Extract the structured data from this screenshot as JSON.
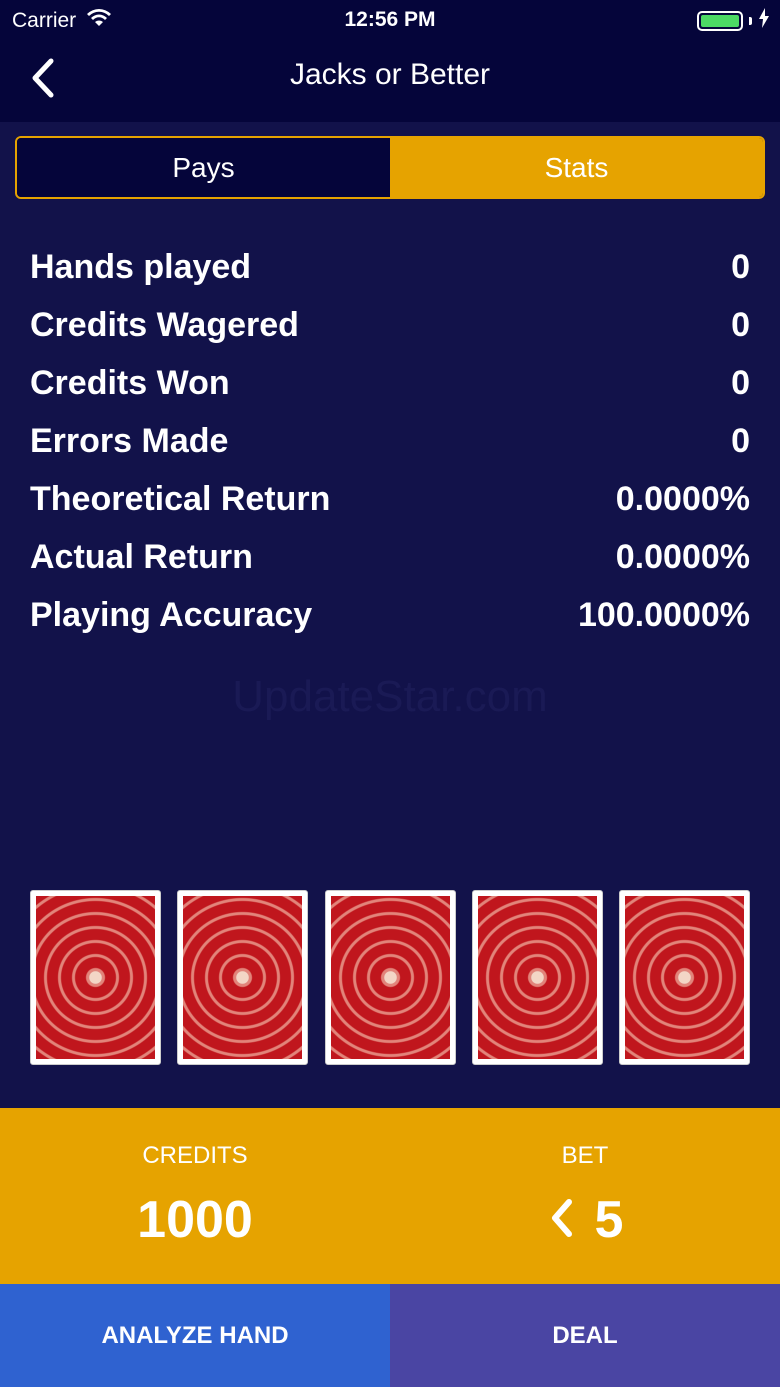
{
  "status_bar": {
    "carrier": "Carrier",
    "time": "12:56 PM",
    "wifi_icon": "wifi-icon",
    "battery_icon": "battery-icon",
    "battery_color": "#4cd964"
  },
  "nav": {
    "title": "Jacks or Better",
    "back_icon": "chevron-left-icon"
  },
  "tabs": [
    {
      "label": "Pays",
      "active": false
    },
    {
      "label": "Stats",
      "active": true
    }
  ],
  "stats": [
    {
      "label": "Hands played",
      "value": "0"
    },
    {
      "label": "Credits Wagered",
      "value": "0"
    },
    {
      "label": "Credits Won",
      "value": "0"
    },
    {
      "label": "Errors Made",
      "value": "0"
    },
    {
      "label": "Theoretical Return",
      "value": "0.0000%"
    },
    {
      "label": "Actual Return",
      "value": "0.0000%"
    },
    {
      "label": "Playing Accuracy",
      "value": "100.0000%"
    }
  ],
  "watermark": "UpdateStar.com",
  "cards": [
    "card-back",
    "card-back",
    "card-back",
    "card-back",
    "card-back"
  ],
  "credits": {
    "label": "CREDITS",
    "value": "1000"
  },
  "bet": {
    "label": "BET",
    "value": "5",
    "decrease_icon": "chevron-left-icon"
  },
  "buttons": {
    "analyze": "ANALYZE HAND",
    "deal": "DEAL"
  },
  "colors": {
    "background": "#12124a",
    "nav_background": "#05053a",
    "accent": "#e6a300",
    "analyze_button": "#2f62d0",
    "deal_button": "#4a45a3"
  }
}
